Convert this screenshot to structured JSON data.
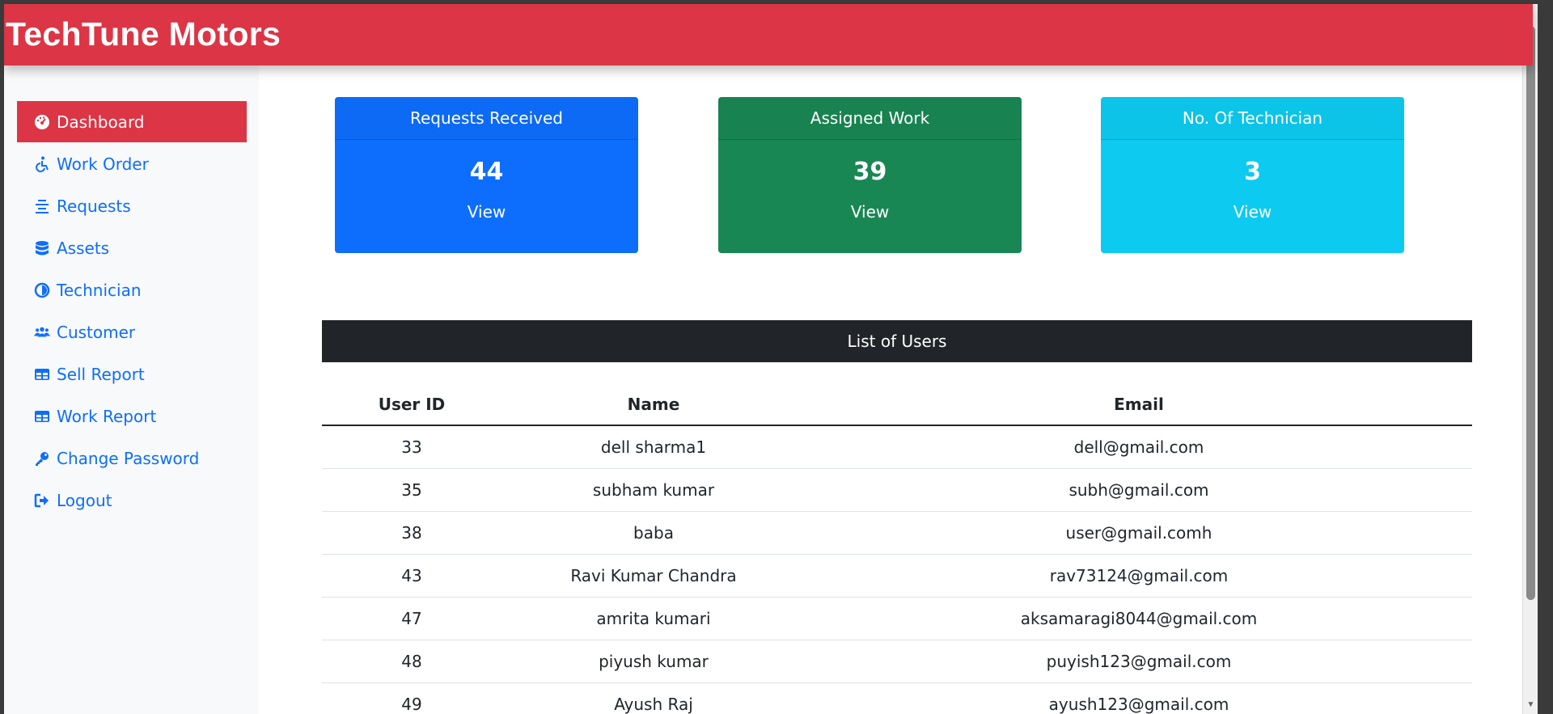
{
  "brand": "TechTune Motors",
  "sidebar": {
    "items": [
      {
        "label": "Dashboard",
        "icon": "dashboard-gauge-icon",
        "active": true
      },
      {
        "label": "Work Order",
        "icon": "accessible-icon",
        "active": false
      },
      {
        "label": "Requests",
        "icon": "align-center-icon",
        "active": false
      },
      {
        "label": "Assets",
        "icon": "database-icon",
        "active": false
      },
      {
        "label": "Technician",
        "icon": "technician-icon",
        "active": false
      },
      {
        "label": "Customer",
        "icon": "users-icon",
        "active": false
      },
      {
        "label": "Sell Report",
        "icon": "table-icon",
        "active": false
      },
      {
        "label": "Work Report",
        "icon": "table-icon",
        "active": false
      },
      {
        "label": "Change Password",
        "icon": "key-icon",
        "active": false
      },
      {
        "label": "Logout",
        "icon": "sign-out-icon",
        "active": false
      }
    ]
  },
  "cards": [
    {
      "title": "Requests Received",
      "value": "44",
      "link": "View",
      "color": "#0d6efd"
    },
    {
      "title": "Assigned Work",
      "value": "39",
      "link": "View",
      "color": "#198754"
    },
    {
      "title": "No. Of Technician",
      "value": "3",
      "link": "View",
      "color": "#0dcaf0"
    }
  ],
  "users_table": {
    "title": "List of Users",
    "columns": [
      "User ID",
      "Name",
      "Email"
    ],
    "rows": [
      [
        "33",
        "dell sharma1",
        "dell@gmail.com"
      ],
      [
        "35",
        "subham kumar",
        "subh@gmail.com"
      ],
      [
        "38",
        "baba",
        "user@gmail.comh"
      ],
      [
        "43",
        "Ravi Kumar Chandra",
        "rav73124@gmail.com"
      ],
      [
        "47",
        "amrita kumari",
        "aksamaragi8044@gmail.com"
      ],
      [
        "48",
        "piyush kumar",
        "puyish123@gmail.com"
      ],
      [
        "49",
        "Ayush Raj",
        "ayush123@gmail.com"
      ]
    ]
  },
  "colors": {
    "brand_red": "#dc3545",
    "link_blue": "#0d6efd",
    "dark": "#212529"
  }
}
